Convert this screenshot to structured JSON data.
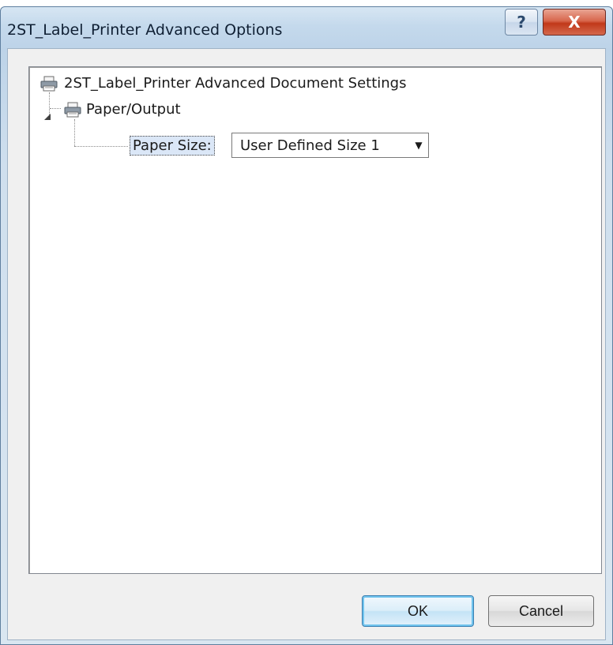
{
  "window": {
    "title": "2ST_Label_Printer Advanced Options",
    "help_label": "?",
    "close_label": "X"
  },
  "tree": {
    "root_label": "2ST_Label_Printer Advanced Document Settings",
    "root_icon": "printer-icon",
    "child_label": "Paper/Output",
    "child_icon": "printer-icon",
    "child_expanded": true,
    "setting_label": "Paper Size:",
    "setting_value": "User Defined Size 1",
    "setting_arrow": "▼"
  },
  "buttons": {
    "ok_label": "OK",
    "cancel_label": "Cancel"
  }
}
